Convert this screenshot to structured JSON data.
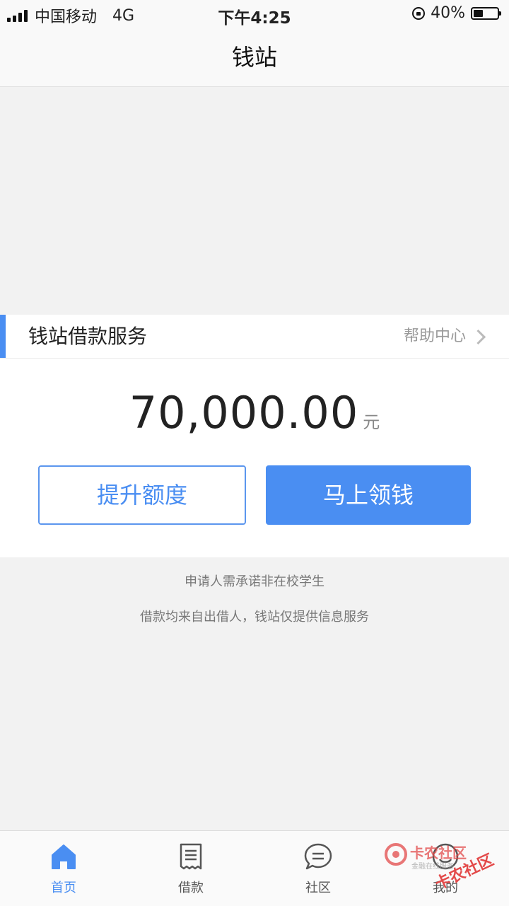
{
  "status_bar": {
    "carrier": "中国移动",
    "network": "4G",
    "time": "下午4:25",
    "battery_percent_label": "40%",
    "battery_level": 0.4,
    "signal_bars": 4
  },
  "nav": {
    "title": "钱站"
  },
  "service": {
    "title": "钱站借款服务",
    "help_label": "帮助中心",
    "accent_color": "#4a8ef2"
  },
  "amount": {
    "value": "70,000.00",
    "unit": "元"
  },
  "buttons": {
    "raise_limit": "提升额度",
    "get_money": "马上领钱"
  },
  "notices": [
    "申请人需承诺非在校学生",
    "借款均来自出借人，钱站仅提供信息服务"
  ],
  "tabs": [
    {
      "label": "首页",
      "icon": "home-icon",
      "active": true
    },
    {
      "label": "借款",
      "icon": "receipt-icon",
      "active": false
    },
    {
      "label": "社区",
      "icon": "chat-icon",
      "active": false
    },
    {
      "label": "我的",
      "icon": "profile-icon",
      "active": false
    }
  ],
  "watermark": {
    "text": "卡农社区",
    "sub_text": "金融在线服务",
    "color": "#e34a4a"
  }
}
